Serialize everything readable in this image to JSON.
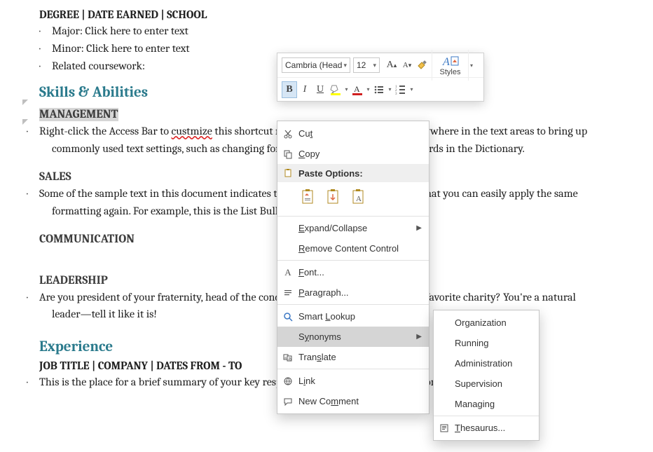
{
  "doc": {
    "degree_heading": "DEGREE | DATE EARNED | SCHOOL",
    "degree_bullets": {
      "major": "Major: Click here to enter text",
      "minor": "Minor: Click here to enter text",
      "coursework": "Related coursework:"
    },
    "skills_heading": "Skills & Abilities",
    "sub_management": "MANAGEMENT",
    "management_text_pre": "Right-click the Access Bar to ",
    "management_misspell": "custmize",
    "management_text_post": " this shortcut menu. Or right-click the same anywhere in the text areas to bring up commonly used text settings, such as changing font type or color and to look up words in the Dictionary.",
    "sub_sales": "SALES",
    "sales_text": "Some of the sample text in this document indicates the name of the style applied, so that you can easily apply the same formatting again. For example, this is the List Bullet style.",
    "sub_comm": "COMMUNICATION",
    "sub_lead": "LEADERSHIP",
    "leadership_text": "Are you president of your fraternity, head of the condo board, or a team lead for your favorite charity? You're a natural leader—tell it like it is!",
    "exp_heading": "Experience",
    "job_heading": "JOB TITLE | COMPANY | DATES FROM - TO",
    "job_text": "This is the place for a brief summary of your key responsibilities and most stellar accomplishments."
  },
  "mini": {
    "font_name": "Cambria (Head",
    "font_size": "12",
    "styles_label": "Styles",
    "bold": "B",
    "italic": "I",
    "underline": "U"
  },
  "ctx": {
    "cut": "Cut",
    "copy": "Copy",
    "paste_header": "Paste Options:",
    "expand": "Expand/Collapse",
    "remove_cc": "Remove Content Control",
    "font": "Font...",
    "paragraph": "Paragraph...",
    "smart": "Smart Lookup",
    "synonyms": "Synonyms",
    "translate": "Translate",
    "link": "Link",
    "comment": "New Comment"
  },
  "syn": {
    "organization": "Organization",
    "running": "Running",
    "administration": "Administration",
    "supervision": "Supervision",
    "managing": "Managing",
    "thesaurus": "Thesaurus..."
  }
}
